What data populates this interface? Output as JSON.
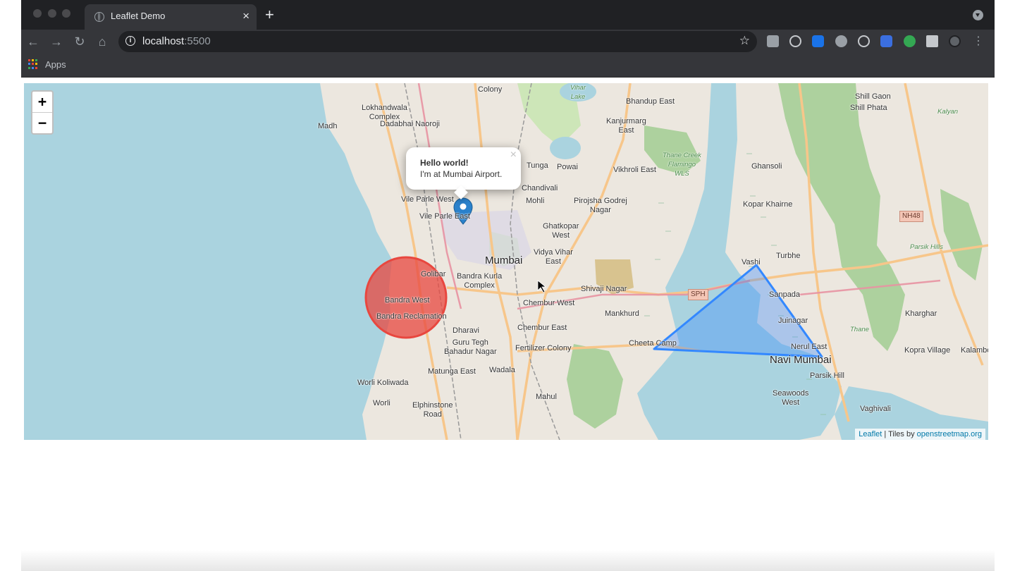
{
  "browser": {
    "tab_title": "Leaflet Demo",
    "tab_close": "×",
    "new_tab": "+",
    "url_host": "localhost",
    "url_port": ":5500",
    "bookmarks_apps": "Apps"
  },
  "colors": {
    "circle_fill": "#e8473f",
    "polygon_stroke": "#3388ff",
    "marker": "#2a81cb",
    "water": "#aad3df"
  },
  "map": {
    "zoom_in": "+",
    "zoom_out": "−",
    "popup_title": "Hello world!",
    "popup_text": "I'm at Mumbai Airport.",
    "popup_close": "×",
    "attribution_leaflet": "Leaflet",
    "attribution_sep": " | Tiles by ",
    "attribution_osm": "openstreetmap.org",
    "labels": {
      "colony": "Colony",
      "lokhandwala": "Lokhandwala\nComplex",
      "madh": "Madh",
      "dadabhai": "Dadabhai Naoroji",
      "bhandup": "Bhandup East",
      "kanjurmarg": "Kanjurmarg\nEast",
      "tunga": "Tunga",
      "powai": "Powai",
      "vikhroli": "Vikhroli East",
      "thane_creek": "Thane Creek\nFlamingo\nWLS",
      "ghansoli": "Ghansoli",
      "shill_gaon": "Shill Gaon",
      "shill_phata": "Shill Phata",
      "chandivali": "Chandivali",
      "mohli": "Mohli",
      "pirojsha": "Pirojsha Godrej\nNagar",
      "vile_parle_west": "Vile Parle West",
      "vile_parle_east": "Vile Parle East",
      "kopar": "Kopar Khairne",
      "nh48": "NH48",
      "ghatkopar": "Ghatkopar\nWest",
      "vidya_vihar": "Vidya Vihar\nEast",
      "mumbai": "Mumbai",
      "turbhe": "Turbhe",
      "parsik": "Parsik Hills",
      "vashi": "Vashi",
      "golibar": "Golibar",
      "bandra_kurla": "Bandra Kurla\nComplex",
      "shivaji": "Shivaji Nagar",
      "sph": "SPH",
      "sanpada": "Sanpada",
      "bandra_west": "Bandra West",
      "chembur_west": "Chembur West",
      "mankhurd": "Mankhurd",
      "kharghar": "Kharghar",
      "bandra_reclamation": "Bandra Reclamation",
      "juinagar": "Juinagar",
      "dharavi": "Dharavi",
      "chembur_east": "Chembur East",
      "guru_tegh": "Guru Tegh\nBahadur Nagar",
      "cheeta_camp": "Cheeta Camp",
      "nerul": "Nerul East",
      "kopra": "Kopra Village",
      "kalambo": "Kalambo",
      "fertilizer": "Fertilizer Colony",
      "navi_mumbai": "Navi Mumbai",
      "matunga": "Matunga East",
      "wadala": "Wadala",
      "parsik_hill": "Parsik Hill",
      "worli_koliwada": "Worli Koliwada",
      "seawoods": "Seawoods\nWest",
      "worli": "Worli",
      "elphinstone": "Elphinstone\nRoad",
      "mahul": "Mahul",
      "vaghivali": "Vaghivali",
      "kalyan": "Kalyan",
      "vihar_lake": "Vihar\nLake",
      "thane": "Thane"
    }
  }
}
